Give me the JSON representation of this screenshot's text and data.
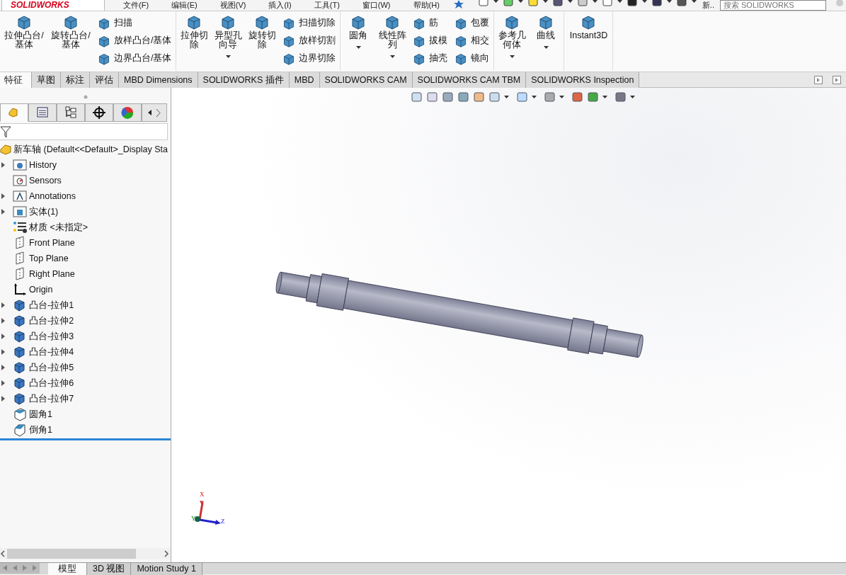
{
  "logo_text": "SOLIDWORKS",
  "menu": [
    "文件(F)",
    "编辑(E)",
    "视图(V)",
    "插入(I)",
    "工具(T)",
    "窗口(W)",
    "帮助(H)"
  ],
  "quick_toolbar": {
    "truncated_label": "新..",
    "search": {
      "placeholder": "搜索 SOLIDWORKS"
    }
  },
  "ribbon": [
    {
      "columns": [
        {
          "kind": "large",
          "label": "拉伸凸台/基体",
          "dropdown": false
        },
        {
          "kind": "large",
          "label": "旋转凸台/基体",
          "dropdown": false
        },
        {
          "kind": "stack",
          "items": [
            "扫描",
            "放样凸台/基体",
            "边界凸台/基体"
          ]
        }
      ]
    },
    {
      "columns": [
        {
          "kind": "large",
          "label": "拉伸切除",
          "dropdown": false
        },
        {
          "kind": "large",
          "label": "异型孔向导",
          "dropdown": true
        },
        {
          "kind": "large",
          "label": "旋转切除",
          "dropdown": false
        },
        {
          "kind": "stack",
          "items": [
            "扫描切除",
            "放样切割",
            "边界切除"
          ]
        }
      ]
    },
    {
      "columns": [
        {
          "kind": "large",
          "label": "圆角",
          "dropdown": true
        },
        {
          "kind": "large",
          "label": "线性阵列",
          "dropdown": true
        },
        {
          "kind": "stack",
          "items": [
            "筋",
            "拔模",
            "抽壳"
          ]
        },
        {
          "kind": "stack",
          "items": [
            "包覆",
            "相交",
            "镜向"
          ]
        }
      ]
    },
    {
      "columns": [
        {
          "kind": "large",
          "label": "参考几何体",
          "dropdown": true
        },
        {
          "kind": "large",
          "label": "曲线",
          "dropdown": true
        }
      ]
    },
    {
      "columns": [
        {
          "kind": "large",
          "label": "Instant3D",
          "dropdown": false
        }
      ]
    }
  ],
  "command_tabs": [
    {
      "label": "特征",
      "selected": true
    },
    {
      "label": "草图",
      "selected": false
    },
    {
      "label": "标注",
      "selected": false
    },
    {
      "label": "评估",
      "selected": false
    },
    {
      "label": "MBD Dimensions",
      "selected": false
    },
    {
      "label": "SOLIDWORKS 插件",
      "selected": false
    },
    {
      "label": "MBD",
      "selected": false
    },
    {
      "label": "SOLIDWORKS CAM",
      "selected": false
    },
    {
      "label": "SOLIDWORKS CAM TBM",
      "selected": false
    },
    {
      "label": "SOLIDWORKS Inspection",
      "selected": false
    }
  ],
  "feature_tree": {
    "panel_tabs": [
      {
        "selected": true
      },
      {
        "selected": false
      },
      {
        "selected": false
      },
      {
        "selected": false
      },
      {
        "selected": false
      }
    ],
    "root": "新车轴  (Default<<Default>_Display Sta",
    "items": [
      {
        "kind": "folder",
        "label": "History",
        "expandable": true
      },
      {
        "kind": "sensor",
        "label": "Sensors",
        "expandable": false
      },
      {
        "kind": "annotation",
        "label": "Annotations",
        "expandable": true
      },
      {
        "kind": "solid",
        "label": "实体(1)",
        "expandable": true
      },
      {
        "kind": "material",
        "label": "材质 <未指定>",
        "expandable": false
      },
      {
        "kind": "plane",
        "label": "Front Plane",
        "expandable": false
      },
      {
        "kind": "plane",
        "label": "Top Plane",
        "expandable": false
      },
      {
        "kind": "plane",
        "label": "Right Plane",
        "expandable": false
      },
      {
        "kind": "origin",
        "label": "Origin",
        "expandable": false
      },
      {
        "kind": "extrude",
        "label": "凸台-拉伸1",
        "expandable": true
      },
      {
        "kind": "extrude",
        "label": "凸台-拉伸2",
        "expandable": true
      },
      {
        "kind": "extrude",
        "label": "凸台-拉伸3",
        "expandable": true
      },
      {
        "kind": "extrude",
        "label": "凸台-拉伸4",
        "expandable": true
      },
      {
        "kind": "extrude",
        "label": "凸台-拉伸5",
        "expandable": true
      },
      {
        "kind": "extrude",
        "label": "凸台-拉伸6",
        "expandable": true
      },
      {
        "kind": "extrude",
        "label": "凸台-拉伸7",
        "expandable": true
      },
      {
        "kind": "fillet",
        "label": "圆角1",
        "expandable": false
      },
      {
        "kind": "chamfer",
        "label": "倒角1",
        "expandable": false
      }
    ]
  },
  "triad": {
    "x": "X",
    "y": "Y",
    "z": "Z"
  },
  "bottom_tabs": [
    {
      "label": "模型",
      "selected": true
    },
    {
      "label": "3D 视图",
      "selected": false
    },
    {
      "label": "Motion Study 1",
      "selected": false
    }
  ]
}
